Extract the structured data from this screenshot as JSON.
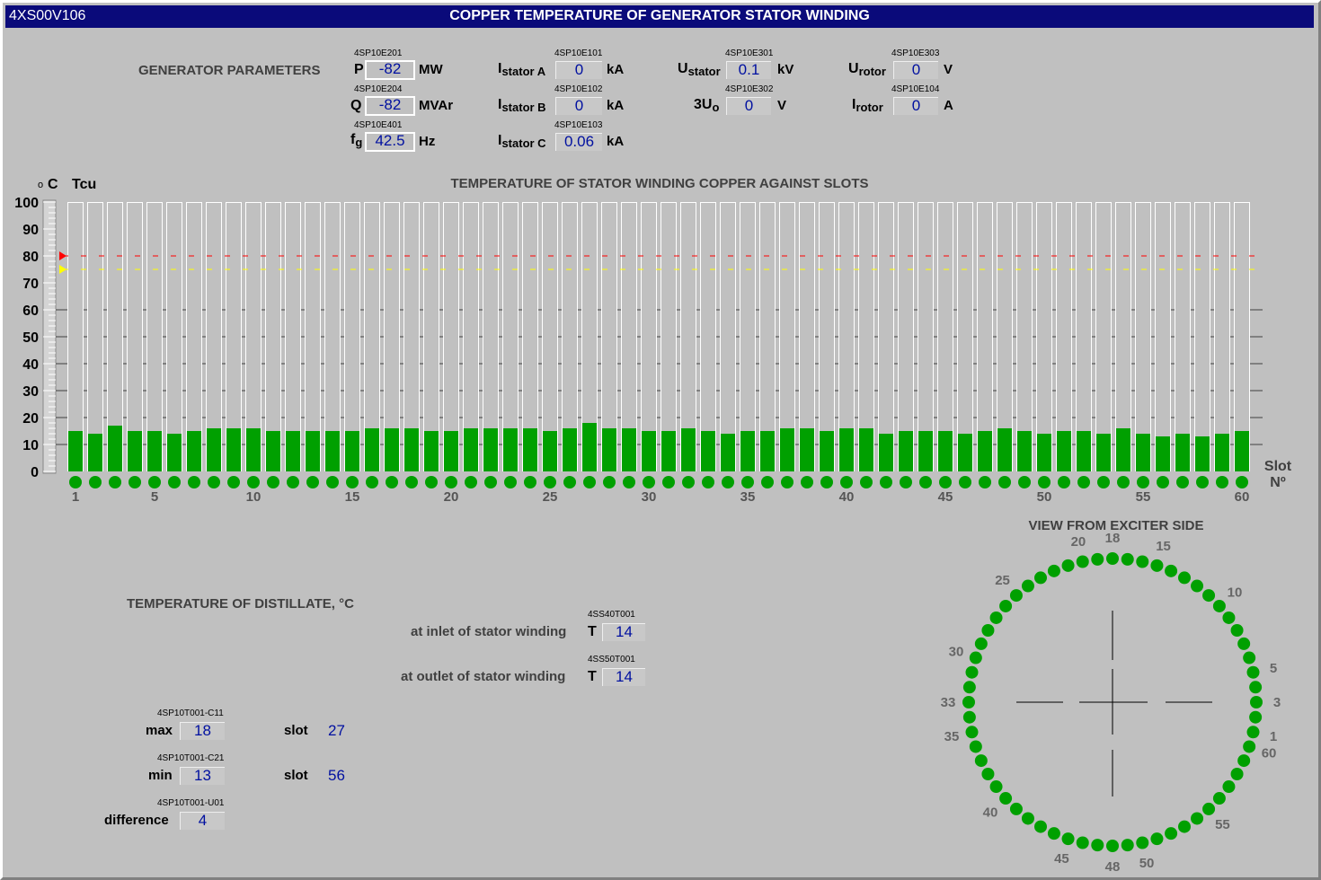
{
  "window": {
    "tag": "4XS00V106",
    "title": "COPPER TEMPERATURE OF GENERATOR STATOR WINDING"
  },
  "gen_params": {
    "heading": "GENERATOR PARAMETERS",
    "P": {
      "tag": "4SP10E201",
      "value": "-82",
      "unit": "MW"
    },
    "Q": {
      "tag": "4SP10E204",
      "value": "-82",
      "unit": "MVAr"
    },
    "fg": {
      "tag": "4SP10E401",
      "value": "42.5",
      "unit": "Hz"
    },
    "IstatorA": {
      "tag": "4SP10E101",
      "value": "0",
      "unit": "kA"
    },
    "IstatorB": {
      "tag": "4SP10E102",
      "value": "0",
      "unit": "kA"
    },
    "IstatorC": {
      "tag": "4SP10E103",
      "value": "0.06",
      "unit": "kA"
    },
    "Ustator": {
      "tag": "4SP10E301",
      "value": "0.1",
      "unit": "kV"
    },
    "U3o": {
      "tag": "4SP10E302",
      "value": "0",
      "unit": "V"
    },
    "Urotor": {
      "tag": "4SP10E303",
      "value": "0",
      "unit": "V"
    },
    "Irotor": {
      "tag": "4SP10E104",
      "value": "0",
      "unit": "A"
    }
  },
  "chart_data": {
    "type": "bar",
    "title": "TEMPERATURE OF STATOR WINDING COPPER AGAINST SLOTS",
    "ylabel_unit": "C",
    "ylabel": "Tcu",
    "xlabel": "Slot",
    "xlabel2": "Nº",
    "ylim": [
      0,
      100
    ],
    "yticks": [
      0,
      10,
      20,
      30,
      40,
      50,
      60,
      70,
      80,
      90,
      100
    ],
    "xticks": [
      1,
      5,
      10,
      15,
      20,
      25,
      30,
      35,
      40,
      45,
      50,
      55,
      60
    ],
    "alarm_limit": 80,
    "warning_limit": 75,
    "colors": {
      "bar": "#00a000",
      "alarm": "#ff0000",
      "warning": "#ffff00",
      "indicator": "#00a000"
    },
    "categories": [
      1,
      2,
      3,
      4,
      5,
      6,
      7,
      8,
      9,
      10,
      11,
      12,
      13,
      14,
      15,
      16,
      17,
      18,
      19,
      20,
      21,
      22,
      23,
      24,
      25,
      26,
      27,
      28,
      29,
      30,
      31,
      32,
      33,
      34,
      35,
      36,
      37,
      38,
      39,
      40,
      41,
      42,
      43,
      44,
      45,
      46,
      47,
      48,
      49,
      50,
      51,
      52,
      53,
      54,
      55,
      56,
      57,
      58,
      59,
      60
    ],
    "values": [
      15,
      14,
      17,
      15,
      15,
      14,
      15,
      16,
      16,
      16,
      15,
      15,
      15,
      15,
      15,
      16,
      16,
      16,
      15,
      15,
      16,
      16,
      16,
      16,
      15,
      16,
      18,
      16,
      16,
      15,
      15,
      16,
      15,
      14,
      15,
      15,
      16,
      16,
      15,
      16,
      16,
      14,
      15,
      15,
      15,
      14,
      15,
      16,
      15,
      14,
      15,
      15,
      14,
      16,
      14,
      13,
      14,
      13,
      14,
      15
    ]
  },
  "ring": {
    "title": "VIEW FROM EXCITER SIDE",
    "labels": [
      "1",
      "3",
      "5",
      "10",
      "15",
      "18",
      "20",
      "25",
      "30",
      "33",
      "35",
      "40",
      "45",
      "48",
      "50",
      "55",
      "60"
    ]
  },
  "distillate": {
    "heading": "TEMPERATURE OF DISTILLATE, °C",
    "inlet": {
      "label": "at inlet of stator winding",
      "tag": "4SS40T001",
      "sym": "T",
      "value": "14"
    },
    "outlet": {
      "label": "at outlet of stator winding",
      "tag": "4SS50T001",
      "sym": "T",
      "value": "14"
    }
  },
  "stats": {
    "max": {
      "label": "max",
      "tag": "4SP10T001-C11",
      "value": "18",
      "slot_label": "slot",
      "slot": "27"
    },
    "min": {
      "label": "min",
      "tag": "4SP10T001-C21",
      "value": "13",
      "slot_label": "slot",
      "slot": "56"
    },
    "difference": {
      "label": "difference",
      "tag": "4SP10T001-U01",
      "value": "4"
    }
  }
}
